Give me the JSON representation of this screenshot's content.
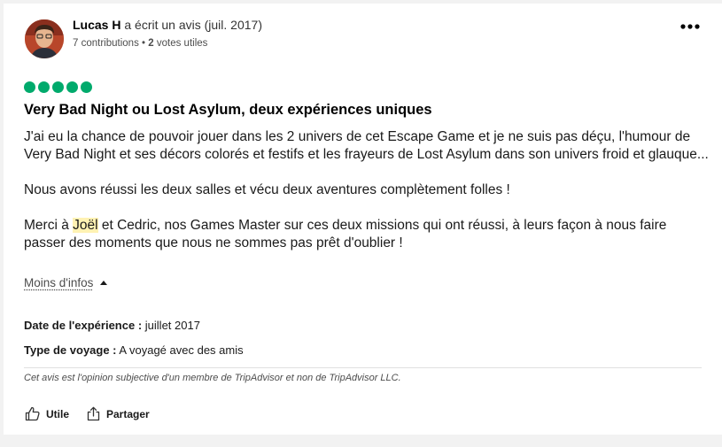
{
  "review": {
    "author": {
      "name": "Lucas H",
      "action_text": "a écrit un avis (juil. 2017)",
      "contributions_count": "7",
      "contributions_label": "contributions",
      "separator": "•",
      "helpful_votes_count": "2",
      "helpful_votes_label": "votes utiles"
    },
    "rating": 5,
    "rating_max": 5,
    "title": "Very Bad Night ou Lost Asylum, deux expériences uniques",
    "paragraph1": "J'ai eu la chance de pouvoir jouer dans les 2 univers de cet Escape Game et je ne suis pas déçu, l'humour de Very Bad Night et ses décors colorés et festifs et les frayeurs de Lost Asylum dans son univers froid et glauque...",
    "paragraph2": "Nous avons réussi les deux salles et vécu deux aventures complètement folles !",
    "paragraph3_before": "Merci à ",
    "paragraph3_highlight": "Joël",
    "paragraph3_after": " et Cedric, nos Games Master sur ces deux missions qui ont réussi, à leurs façon à nous faire passer des moments que nous ne sommes pas prêt d'oublier !",
    "less_info_label": "Moins d'infos",
    "experience_date_label": "Date de l'expérience :",
    "experience_date_value": "juillet 2017",
    "trip_type_label": "Type de voyage :",
    "trip_type_value": "A voyagé avec des amis",
    "disclaimer": "Cet avis est l'opinion subjective d'un membre de TripAdvisor et non de TripAdvisor LLC.",
    "actions": {
      "helpful_label": "Utile",
      "share_label": "Partager"
    }
  },
  "colors": {
    "bubble_green": "#00aa6c",
    "highlight": "#fff2b3"
  },
  "icons": {
    "menu": "more-horizontal-icon",
    "less_info": "caret-up-icon",
    "helpful": "thumbs-up-icon",
    "share": "share-icon"
  }
}
